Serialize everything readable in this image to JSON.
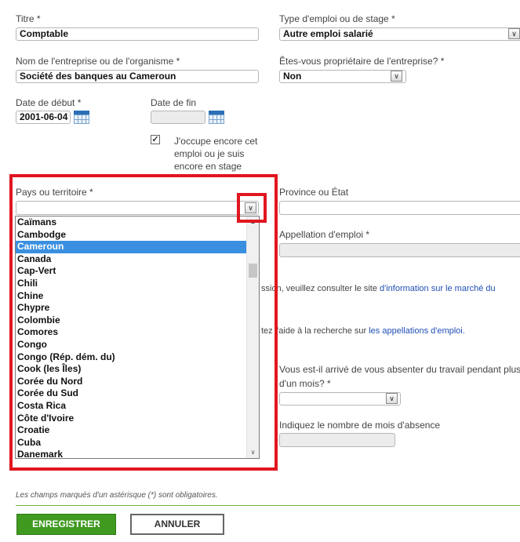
{
  "fields": {
    "title": {
      "label": "Titre *",
      "value": "Comptable"
    },
    "job_type": {
      "label": "Type d'emploi ou de stage *",
      "value": "Autre emploi salarié"
    },
    "company": {
      "label": "Nom de l'entreprise ou de l'organisme *",
      "value": "Société des banques au Cameroun"
    },
    "owner": {
      "label": "Êtes-vous propriétaire de l'entreprise? *",
      "value": "Non"
    },
    "start_date": {
      "label": "Date de début *",
      "value": "2001-06-04"
    },
    "end_date": {
      "label": "Date de fin",
      "value": ""
    },
    "current_job": {
      "label": "J'occupe encore cet emploi ou je suis encore en stage",
      "checked": true
    },
    "country": {
      "label": "Pays ou territoire *",
      "value": ""
    },
    "province": {
      "label": "Province ou État",
      "value": ""
    },
    "job_name": {
      "label": "Appellation d'emploi *",
      "value": ""
    },
    "absence": {
      "label": "Vous est-il arrivé de vous absenter du travail pendant plus d'un mois? *",
      "value": ""
    },
    "absence_months": {
      "label": "Indiquez le nombre de mois d'absence",
      "value": ""
    }
  },
  "info": {
    "line1_prefix": "ssion, veuillez consulter le site ",
    "line1_link": "d'information sur le marché du",
    "line2_prefix": "tez l'aide à la recherche sur ",
    "line2_link": "les appellations d'emploi."
  },
  "country_options": [
    "Caïmans",
    "Cambodge",
    "Cameroun",
    "Canada",
    "Cap-Vert",
    "Chili",
    "Chine",
    "Chypre",
    "Colombie",
    "Comores",
    "Congo",
    "Congo (Rép. dém. du)",
    "Cook (les Îles)",
    "Corée du Nord",
    "Corée du Sud",
    "Costa Rica",
    "Côte d'Ivoire",
    "Croatie",
    "Cuba",
    "Danemark"
  ],
  "selected_country": "Cameroun",
  "footnote": "Les champs marqués d'un astérisque (*) sont obligatoires.",
  "buttons": {
    "save": "ENREGISTRER",
    "cancel": "ANNULER"
  },
  "colors": {
    "highlight": "#e0161f",
    "selection": "#3a8fe0",
    "primary": "#3f9a1f",
    "link": "#1f4fb5"
  }
}
